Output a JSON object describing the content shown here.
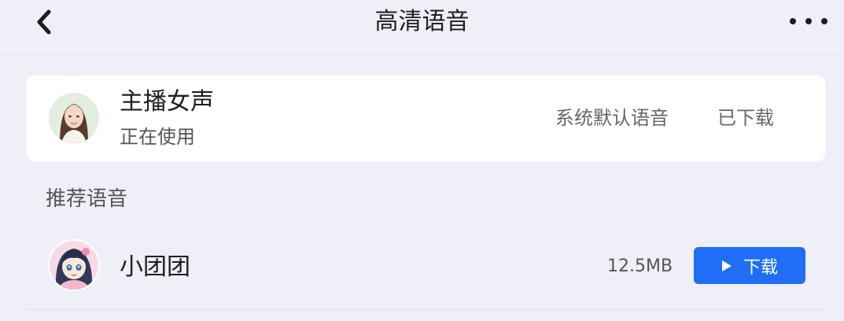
{
  "header": {
    "back_icon": "chevron-left-icon",
    "title": "高清语音",
    "more_icon": "more-horizontal-icon"
  },
  "current_voice": {
    "name": "主播女声",
    "status": "正在使用",
    "default_label": "系统默认语音",
    "download_state": "已下载",
    "avatar_icon": "female-avatar"
  },
  "recommended": {
    "section_title": "推荐语音",
    "items": [
      {
        "name": "小团团",
        "size": "12.5MB",
        "download_label": "下载",
        "avatar_icon": "anime-girl-avatar",
        "play_icon": "play-triangle-icon"
      }
    ]
  },
  "colors": {
    "background": "#eff0f7",
    "card": "#ffffff",
    "accent": "#1f6ef5"
  }
}
